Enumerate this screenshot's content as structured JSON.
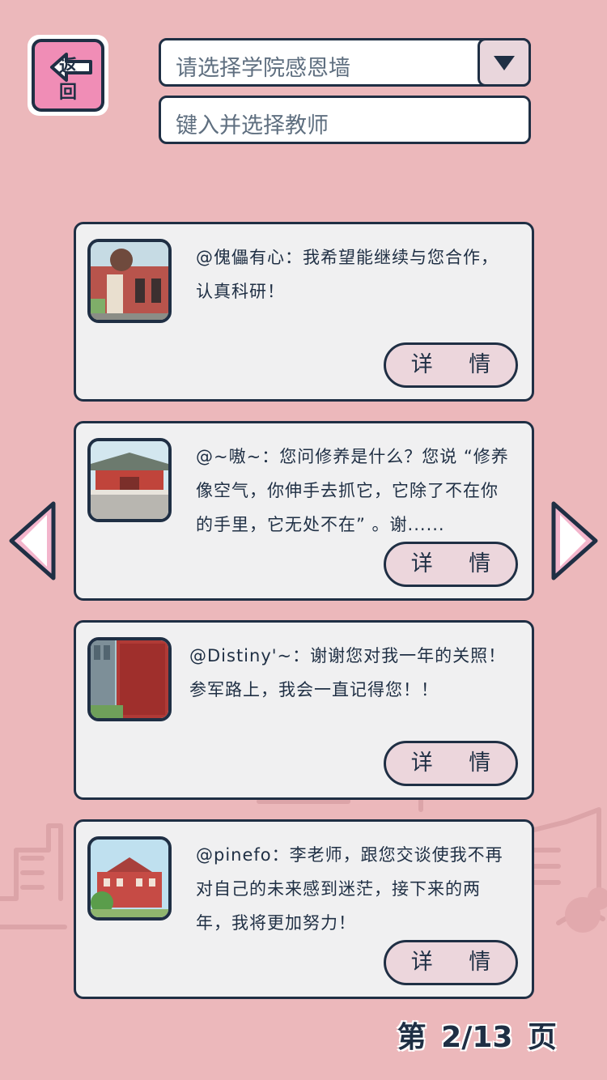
{
  "header": {
    "back_label": "返 回",
    "college_select": {
      "placeholder": "请选择学院感恩墙"
    },
    "teacher_input": {
      "placeholder": "键入并选择教师"
    }
  },
  "cards": [
    {
      "message": "@傀儡有心：我希望能继续与您合作，认真科研！",
      "detail_label": "详 情"
    },
    {
      "message": "@~嗷~：您问修养是什么？您说 “修养像空气，你伸手去抓它，它除了不在你的手里，它无处不在” 。谢......",
      "detail_label": "详 情"
    },
    {
      "message": "@Distiny'~：谢谢您对我一年的关照！参军路上，我会一直记得您！！",
      "detail_label": "详 情"
    },
    {
      "message": "@pinefo：李老师，跟您交谈使我不再对自己的未来感到迷茫，接下来的两年，我将更加努力！",
      "detail_label": "详 情"
    }
  ],
  "pager": {
    "text": "第 2/13 页"
  },
  "colors": {
    "background": "#ecb8bb",
    "dark": "#1f2f44",
    "accent_pink": "#f08db6",
    "card": "#f0f0f1"
  }
}
